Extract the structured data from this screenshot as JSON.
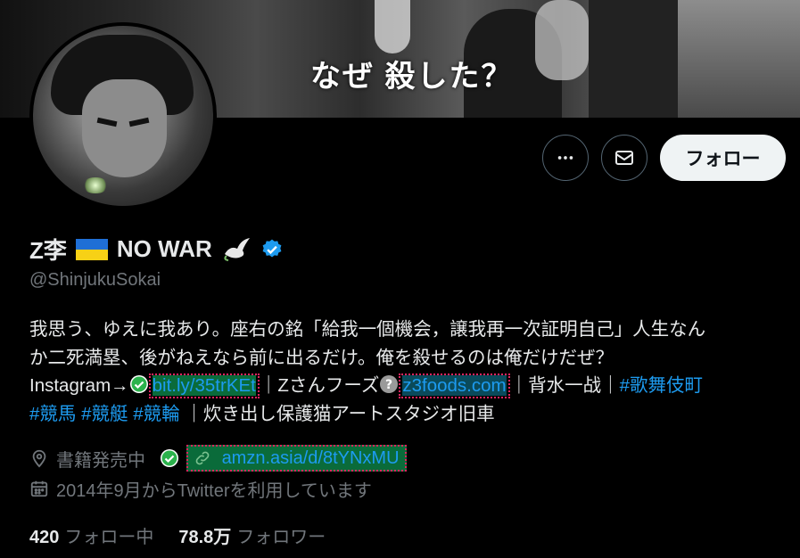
{
  "banner": {
    "caption": "なぜ 殺した？"
  },
  "actions": {
    "follow_label": "フォロー"
  },
  "profile": {
    "name": "Z李",
    "name_suffix": "NO WAR",
    "handle": "@ShinjukuSokai",
    "verified": true
  },
  "bio": {
    "line1": "我思う、ゆえに我あり。座右の銘「給我一個機会，譲我再一次証明自己」人生なん",
    "line2": "か二死満塁、後がねえなら前に出るだけ。俺を殺せるのは俺だけだぜ？",
    "instagram_prefix": "Instagram→",
    "instagram_link": "bit.ly/35trKEt",
    "mid_text": "｜Zさんフーズ",
    "foods_link": "z3foods.com",
    "after_foods": "｜背水一战｜",
    "tag_kabukicho": "#歌舞伎町",
    "tag_keiba": "#競馬",
    "tag_kyotei": "#競艇",
    "tag_keirin": "#競輪",
    "last_text": "｜炊き出し保護猫アートスタジオ旧車"
  },
  "meta": {
    "location": "書籍発売中",
    "url": "amzn.asia/d/8tYNxMU",
    "joined": "2014年9月からTwitterを利用しています"
  },
  "stats": {
    "following_count": "420",
    "following_label": "フォロー中",
    "followers_count": "78.8万",
    "followers_label": "フォロワー"
  },
  "colors": {
    "accent": "#1d9bf0",
    "muted": "#71767b",
    "text": "#e7e9ea"
  },
  "icons": [
    "more-icon",
    "mail-icon",
    "verified-badge-icon",
    "dove-icon",
    "location-icon",
    "link-icon",
    "calendar-icon",
    "check-circle-icon",
    "question-icon"
  ]
}
